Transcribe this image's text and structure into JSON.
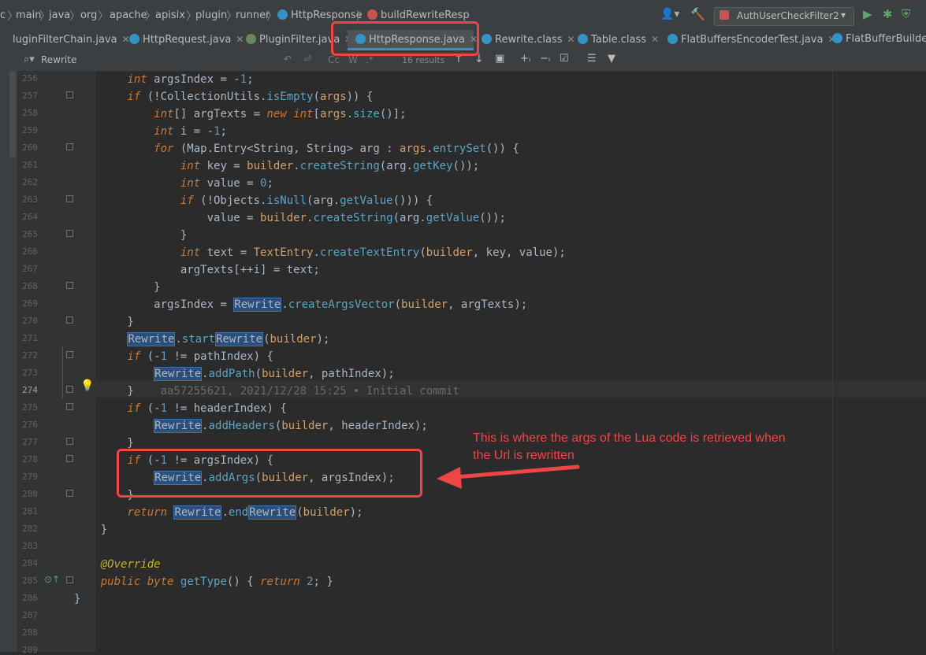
{
  "breadcrumb": [
    "c",
    "main",
    "java",
    "org",
    "apache",
    "apisix",
    "plugin",
    "runner",
    "HttpResponse",
    "buildRewriteResp"
  ],
  "run_config": "AuthUserCheckFilter2",
  "tabs": [
    {
      "label": "luginFilterChain.java",
      "icon": "class-icon"
    },
    {
      "label": "HttpRequest.java",
      "icon": "class-icon"
    },
    {
      "label": "PluginFilter.java",
      "icon": "interface-icon"
    },
    {
      "label": "HttpResponse.java",
      "icon": "class-icon",
      "active": true
    },
    {
      "label": "Rewrite.class",
      "icon": "class-icon"
    },
    {
      "label": "Table.class",
      "icon": "class-icon"
    },
    {
      "label": "FlatBuffersEncoderTest.java",
      "icon": "class-icon"
    },
    {
      "label": "FlatBufferBuilder.c",
      "icon": "class-icon"
    }
  ],
  "find": {
    "query": "Rewrite",
    "results": "16 results",
    "cc": "Cc",
    "w": "W",
    "regex": ".*"
  },
  "line_numbers": [
    "256",
    "257",
    "258",
    "259",
    "260",
    "261",
    "262",
    "263",
    "264",
    "265",
    "266",
    "267",
    "268",
    "269",
    "270",
    "271",
    "272",
    "273",
    "274",
    "275",
    "276",
    "277",
    "278",
    "279",
    "280",
    "281",
    "282",
    "283",
    "284",
    "285",
    "286",
    "287",
    "288",
    "289"
  ],
  "blame": "aa57255621, 2021/12/28 15:25 • Initial commit",
  "annotation": {
    "note": "This is where the args of the Lua code is retrieved when the Url is rewritten"
  },
  "colors": {
    "highlight": "#f04545",
    "accent": "#4a88c7"
  }
}
